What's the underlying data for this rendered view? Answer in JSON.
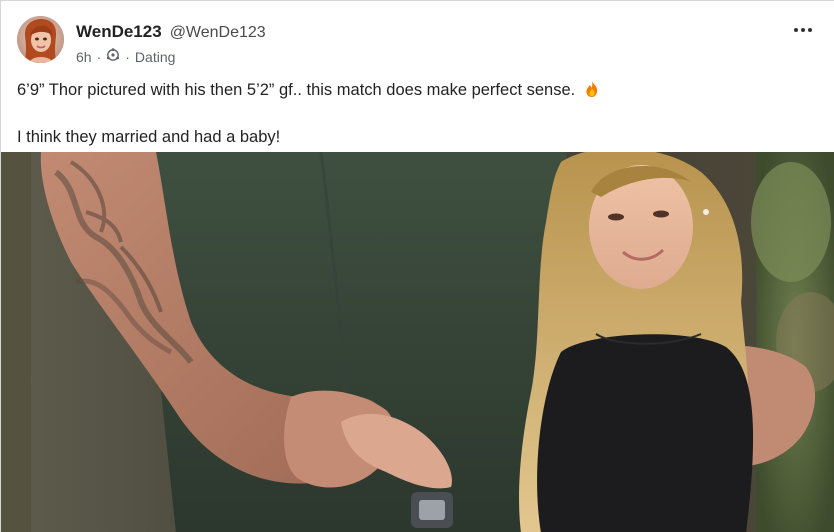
{
  "author": {
    "display_name": "WenDe123",
    "handle": "@WenDe123",
    "avatar_icon": "avatar-icon"
  },
  "meta": {
    "time": "6h",
    "separator": "·",
    "community_icon": "community-icon",
    "category": "Dating"
  },
  "post": {
    "line1": "6’9” Thor pictured with his then 5’2” gf.. this match does make perfect sense.",
    "emoji_icon": "fire-icon",
    "line2": "I think they married and had a baby!"
  },
  "menu": {
    "icon": "more-options-icon"
  },
  "colors": {
    "background": "#ffffff",
    "text": "#1f1f1f",
    "muted": "#5f6368",
    "fire_orange": "#f57c00"
  }
}
